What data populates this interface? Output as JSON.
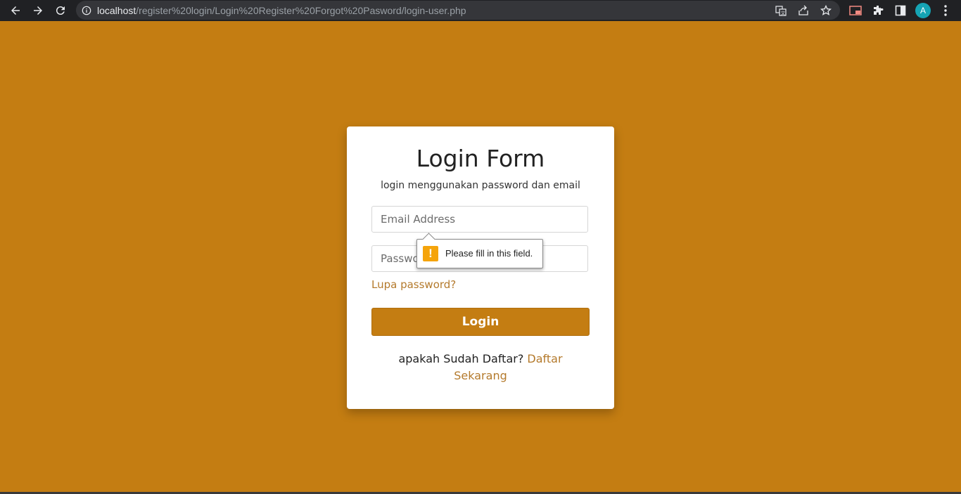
{
  "browser": {
    "url_host": "localhost",
    "url_path": "/register%20login/Login%20Register%20Forgot%20Pasword/login-user.php",
    "avatar_letter": "A",
    "icons": [
      "back-icon",
      "forward-icon",
      "reload-icon",
      "info-icon",
      "translate-icon",
      "share-icon",
      "star-icon",
      "cast-icon",
      "extensions-icon",
      "side-panel-icon",
      "menu-icon"
    ]
  },
  "form": {
    "title": "Login Form",
    "subtitle": "login menggunakan password dan email",
    "email_placeholder": "Email Address",
    "password_placeholder": "Password",
    "forgot_label": "Lupa password?",
    "login_label": "Login",
    "footer_text": "apakah Sudah Daftar?",
    "footer_link": "Daftar Sekarang"
  },
  "tooltip": {
    "icon": "warning-icon",
    "text": "Please fill in this field."
  },
  "colors": {
    "page_background": "#c47d12",
    "link": "#b47a2c",
    "warning": "#f5a40b"
  }
}
